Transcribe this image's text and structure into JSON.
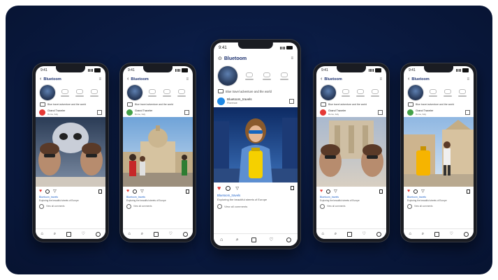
{
  "status_time": "9:41",
  "app": {
    "screen_title": "Bluetoom",
    "big_screen_title": "Bluetoom",
    "bio_text": "Blue travel adventure and the world",
    "caption_line1": "Bluetoom_travels",
    "caption_line2": "Exploring the beautiful streets of Europe",
    "comment_placeholder": "View all comments"
  },
  "posts": [
    {
      "name": "Grand Traveler",
      "location": "Rome, Italy"
    },
    {
      "name": "Grand Traveler",
      "location": "Rome, Italy"
    },
    {
      "name": "Bluetoom_travels",
      "location": "Florence"
    },
    {
      "name": "Grand Traveler",
      "location": "Rome, Italy"
    },
    {
      "name": "Grand Traveler",
      "location": "Rome, Italy"
    }
  ],
  "colors": {
    "background": "#0a1a40",
    "accent": "#1a5fc8",
    "like": "#e53935"
  },
  "icons": [
    "back-icon",
    "more-icon",
    "heart-icon",
    "comment-icon",
    "send-icon",
    "bookmark-icon",
    "home-icon",
    "search-icon",
    "add-icon",
    "activity-icon",
    "profile-icon"
  ]
}
